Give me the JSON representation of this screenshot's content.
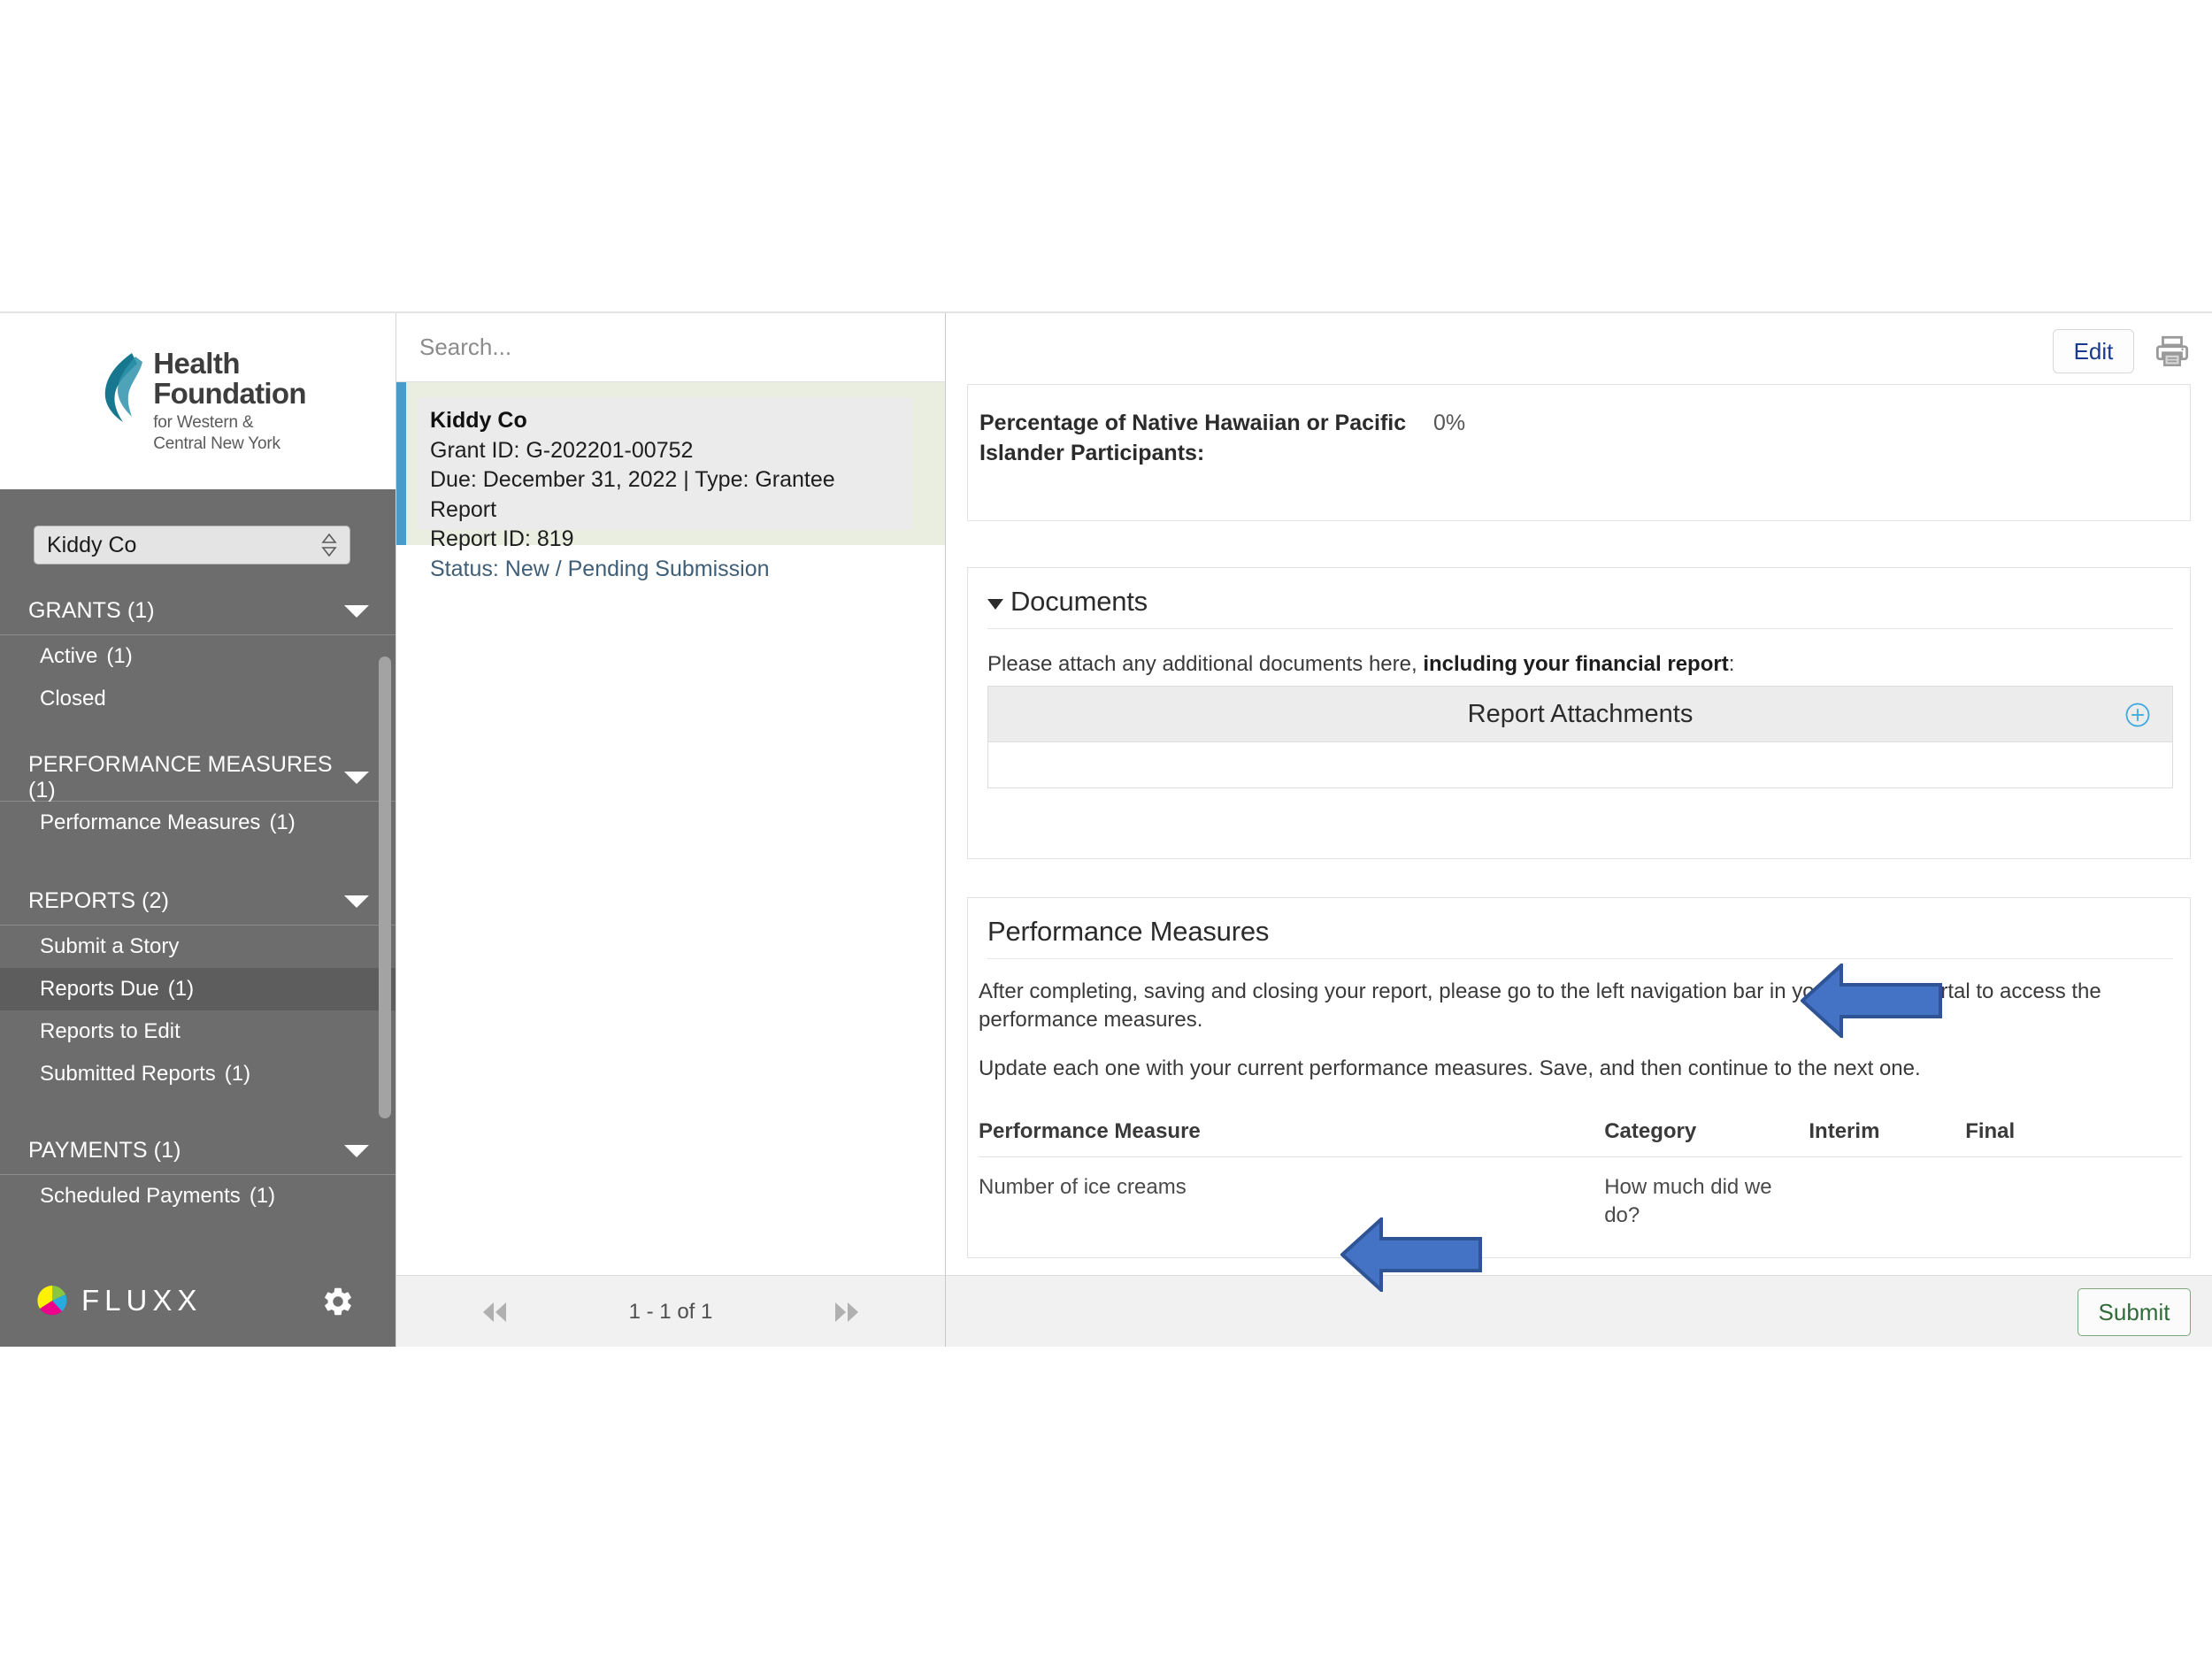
{
  "sidebar": {
    "logo": {
      "line1": "Health",
      "line2": "Foundation",
      "sub1": "for Western &",
      "sub2": "Central New York"
    },
    "org_selector": {
      "value": "Kiddy Co"
    },
    "groups": [
      {
        "label": "GRANTS (1)",
        "items": [
          {
            "label": "Active",
            "count": "(1)",
            "active": false
          },
          {
            "label": "Closed",
            "count": "",
            "active": false
          }
        ]
      },
      {
        "label": "PERFORMANCE MEASURES (1)",
        "items": [
          {
            "label": "Performance Measures",
            "count": "(1)",
            "active": false
          }
        ]
      },
      {
        "label": "REPORTS (2)",
        "items": [
          {
            "label": "Submit a Story",
            "count": "",
            "active": false
          },
          {
            "label": "Reports Due",
            "count": "(1)",
            "active": true
          },
          {
            "label": "Reports to Edit",
            "count": "",
            "active": false
          },
          {
            "label": "Submitted Reports",
            "count": "(1)",
            "active": false
          }
        ]
      },
      {
        "label": "PAYMENTS (1)",
        "items": [
          {
            "label": "Scheduled Payments",
            "count": "(1)",
            "active": false
          }
        ]
      }
    ],
    "footer": {
      "brand": "FLUXX",
      "settings_icon": "gear-icon"
    }
  },
  "list_panel": {
    "search": {
      "placeholder": "Search...",
      "value": ""
    },
    "record": {
      "title": "Kiddy Co",
      "grant_id": "Grant ID: G-202201-00752",
      "due_type": "Due: December 31, 2022 | Type: Grantee Report",
      "report_id": "Report ID: 819",
      "status": "Status: New / Pending Submission"
    },
    "footer": {
      "first_icon": "double-left-arrow-icon",
      "page_label": "1 - 1 of 1",
      "last_icon": "double-right-arrow-icon"
    }
  },
  "detail": {
    "toolbar": {
      "edit_label": "Edit",
      "print_icon": "printer-icon"
    },
    "demographics": {
      "label": "Percentage of Native Hawaiian or Pacific Islander Participants:",
      "value": "0%"
    },
    "documents": {
      "title": "Documents",
      "instruction_plain": "Please attach any additional documents here, ",
      "instruction_bold": "including your financial report",
      "instruction_tail": ":",
      "attachments_header": "Report Attachments",
      "add_icon": "plus-circle-icon"
    },
    "performance": {
      "title": "Performance Measures",
      "paragraph1": "After completing, saving and closing your report, please go to the left navigation bar in your grantee portal to access the performance measures.",
      "paragraph2": "Update each one with your current performance measures. Save, and then continue to the next one.",
      "columns": [
        "Performance Measure",
        "Category",
        "Interim",
        "Final"
      ],
      "rows": [
        {
          "measure": "Number of ice creams",
          "category": "How much did we do?",
          "interim": "",
          "final": ""
        }
      ]
    },
    "footer": {
      "submit_label": "Submit"
    }
  },
  "annotations": {
    "arrow_color_fill": "#4472C4",
    "arrow_color_stroke": "#2F5496",
    "arrows": [
      {
        "name": "arrow-pointing-to-documents-attachment"
      },
      {
        "name": "arrow-pointing-to-performance-measures"
      }
    ]
  },
  "colors": {
    "sidebar_bg": "#6d6d6d",
    "sidebar_active": "#5d5d5d",
    "accent_teal": "#4a9bc8",
    "card_green": "#e9eee1",
    "link_blue": "#1a3a8f",
    "submit_green": "#2f6b38"
  }
}
